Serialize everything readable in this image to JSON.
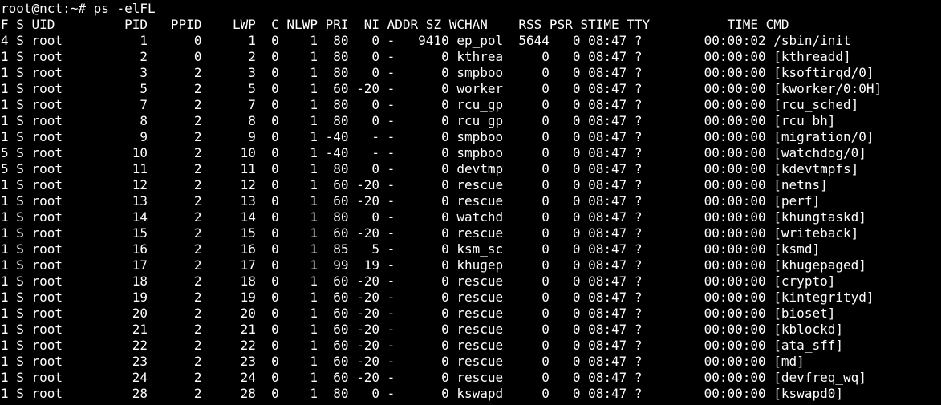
{
  "terminal": {
    "prompt": "root@nct:~# ps -elFL",
    "header": "F S UID         PID   PPID    LWP  C NLWP PRI  NI ADDR SZ WCHAN    RSS PSR STIME TTY          TIME CMD",
    "rows": [
      "4 S root          1      0      1  0    1  80   0 -   9410 ep_pol  5644   0 08:47 ?        00:00:02 /sbin/init",
      "1 S root          2      0      2  0    1  80   0 -      0 kthrea     0   0 08:47 ?        00:00:00 [kthreadd]",
      "1 S root          3      2      3  0    1  80   0 -      0 smpboo     0   0 08:47 ?        00:00:00 [ksoftirqd/0]",
      "1 S root          5      2      5  0    1  60 -20 -      0 worker     0   0 08:47 ?        00:00:00 [kworker/0:0H]",
      "1 S root          7      2      7  0    1  80   0 -      0 rcu_gp     0   0 08:47 ?        00:00:00 [rcu_sched]",
      "1 S root          8      2      8  0    1  80   0 -      0 rcu_gp     0   0 08:47 ?        00:00:00 [rcu_bh]",
      "1 S root          9      2      9  0    1 -40   - -      0 smpboo     0   0 08:47 ?        00:00:00 [migration/0]",
      "5 S root         10      2     10  0    1 -40   - -      0 smpboo     0   0 08:47 ?        00:00:00 [watchdog/0]",
      "5 S root         11      2     11  0    1  80   0 -      0 devtmp     0   0 08:47 ?        00:00:00 [kdevtmpfs]",
      "1 S root         12      2     12  0    1  60 -20 -      0 rescue     0   0 08:47 ?        00:00:00 [netns]",
      "1 S root         13      2     13  0    1  60 -20 -      0 rescue     0   0 08:47 ?        00:00:00 [perf]",
      "1 S root         14      2     14  0    1  80   0 -      0 watchd     0   0 08:47 ?        00:00:00 [khungtaskd]",
      "1 S root         15      2     15  0    1  60 -20 -      0 rescue     0   0 08:47 ?        00:00:00 [writeback]",
      "1 S root         16      2     16  0    1  85   5 -      0 ksm_sc     0   0 08:47 ?        00:00:00 [ksmd]",
      "1 S root         17      2     17  0    1  99  19 -      0 khugep     0   0 08:47 ?        00:00:00 [khugepaged]",
      "1 S root         18      2     18  0    1  60 -20 -      0 rescue     0   0 08:47 ?        00:00:00 [crypto]",
      "1 S root         19      2     19  0    1  60 -20 -      0 rescue     0   0 08:47 ?        00:00:00 [kintegrityd]",
      "1 S root         20      2     20  0    1  60 -20 -      0 rescue     0   0 08:47 ?        00:00:00 [bioset]",
      "1 S root         21      2     21  0    1  60 -20 -      0 rescue     0   0 08:47 ?        00:00:00 [kblockd]",
      "1 S root         22      2     22  0    1  60 -20 -      0 rescue     0   0 08:47 ?        00:00:00 [ata_sff]",
      "1 S root         23      2     23  0    1  60 -20 -      0 rescue     0   0 08:47 ?        00:00:00 [md]",
      "1 S root         24      2     24  0    1  60 -20 -      0 rescue     0   0 08:47 ?        00:00:00 [devfreq_wq]",
      "1 S root         28      2     28  0    1  80   0 -      0 kswapd     0   0 08:47 ?        00:00:00 [kswapd0]"
    ]
  },
  "colors": {
    "background": "#000000",
    "foreground": "#ffffff"
  }
}
